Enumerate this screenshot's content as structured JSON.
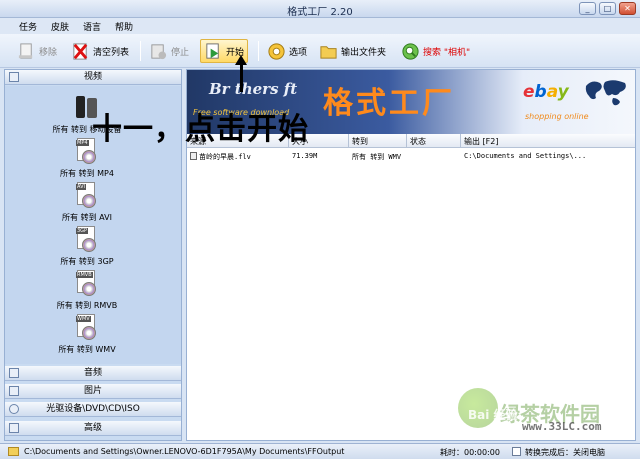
{
  "window": {
    "title": "格式工厂 2.20"
  },
  "menu": [
    "任务",
    "皮肤",
    "语言",
    "帮助"
  ],
  "toolbar": {
    "remove": "移除",
    "clear": "清空列表",
    "stop": "停止",
    "start": "开始",
    "options": "选项",
    "output_folder": "输出文件夹",
    "search": "搜索 \"相机\""
  },
  "sidebar": {
    "video": "视频",
    "audio": "音频",
    "image": "图片",
    "rom": "光驱设备\\DVD\\CD\\ISO",
    "advanced": "高级",
    "items": [
      {
        "tag": "",
        "label": "所有 转到 移动设备"
      },
      {
        "tag": "MP4",
        "label": "所有 转到 MP4"
      },
      {
        "tag": "AVI",
        "label": "所有 转到 AVI"
      },
      {
        "tag": "3GP",
        "label": "所有 转到 3GP"
      },
      {
        "tag": "RMVB",
        "label": "所有 转到 RMVB"
      },
      {
        "tag": "WMV",
        "label": "所有 转到 WMV"
      }
    ]
  },
  "banner": {
    "brand": "Br thers ft",
    "brand_sub": "Free software download",
    "title": "格式工厂",
    "ebay": [
      "e",
      "b",
      "a",
      "y"
    ],
    "shopping": "shopping online"
  },
  "table": {
    "headers": [
      "来源",
      "大小",
      "转到",
      "状态",
      "输出 [F2]"
    ],
    "rows": [
      {
        "source": "苗岭的早晨.flv",
        "size": "71.39M",
        "convert": "所有 转到 WMV",
        "status": "",
        "output": "C:\\Documents and Settings\\..."
      }
    ]
  },
  "annotation": "十一，点击开始",
  "watermark": {
    "line1": "绿茶软件园",
    "line2": "www.33LC.com",
    "baidu": "Bai 经验"
  },
  "status": {
    "path": "C:\\Documents and Settings\\Owner.LENOVO-6D1F795A\\My Documents\\FFOutput",
    "elapsed": "耗时：00:00:00",
    "after_done": "转换完成后：关闭电脑"
  }
}
